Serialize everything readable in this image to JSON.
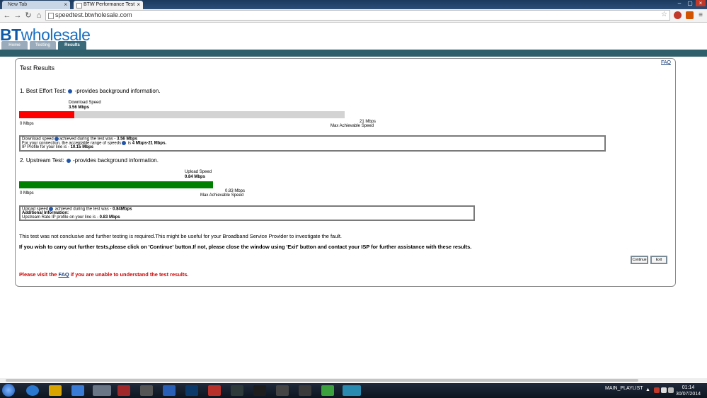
{
  "browser": {
    "tabs": [
      {
        "label": "New Tab",
        "active": false
      },
      {
        "label": "BTW Performance Test",
        "active": true
      }
    ],
    "url": "speedtest.btwholesale.com"
  },
  "site": {
    "logo_prefix": "BT",
    "logo_text": "wholesale",
    "nav_tabs": [
      "Home",
      "Testing",
      "Results"
    ],
    "faq_label": "FAQ"
  },
  "results": {
    "title": "Test Results",
    "best_effort": {
      "heading": "1. Best Effort Test:",
      "heading_suffix": "-provides background information.",
      "gauge_label": "Download  Speed",
      "gauge_value_label": "3.56 Mbps",
      "value": 3.56,
      "max": 21,
      "min_label": "0 Mbps",
      "max_label": "21 Mbps",
      "max_caption": "Max Achievable Speed",
      "summary_line1_prefix": "Download speed",
      "summary_line1_mid": "achieved during the test was - ",
      "summary_line1_value": "3.56 Mbps",
      "summary_line2_prefix": "For your connection, the acceptable range of speeds",
      "summary_line2_mid": " is ",
      "summary_line2_value": "4 Mbps-21 Mbps.",
      "summary_line3_prefix": "IP Profile for your line is - ",
      "summary_line3_value": "10.15 Mbps"
    },
    "upstream": {
      "heading": "2. Upstream Test:",
      "heading_suffix": "-provides background information.",
      "gauge_label": "Upload Speed",
      "gauge_value_label": "0.84 Mbps",
      "value": 0.84,
      "max": 0.83,
      "min_label": "0 Mbps",
      "max_label": "0.83 Mbps",
      "max_caption": "Max Achievable Speed",
      "summary_line1_prefix": "Upload speed",
      "summary_line1_mid": " achieved during the test was - ",
      "summary_line1_value": "0.84Mbps",
      "summary_line2": "Additional Information:",
      "summary_line3_prefix": "Upstream Rate IP profile on your line is - ",
      "summary_line3_value": "0.83 Mbps"
    },
    "conclusion": "This test was not conclusive and further testing is required.This might be useful for your Broadband Service Provider to investigate the fault.",
    "instruction": "If you wish to carry out further tests,please click on 'Continue' button.If not, please close the window using 'Exit' button and contact your ISP for further assistance with these results.",
    "continue_label": "Continue",
    "exit_label": "Exit",
    "visit_prefix": "Please visit the ",
    "visit_link": "FAQ",
    "visit_suffix": " if you are unable to understand the test results."
  },
  "colors": {
    "download_bar": "#ff0000",
    "upload_bar": "#008000",
    "accent_teal": "#2f5f6a",
    "warning_text": "#cc0000"
  },
  "taskbar": {
    "tray_label": "MAIN_PLAYLIST",
    "time": "01:14",
    "date": "30/07/2014"
  }
}
